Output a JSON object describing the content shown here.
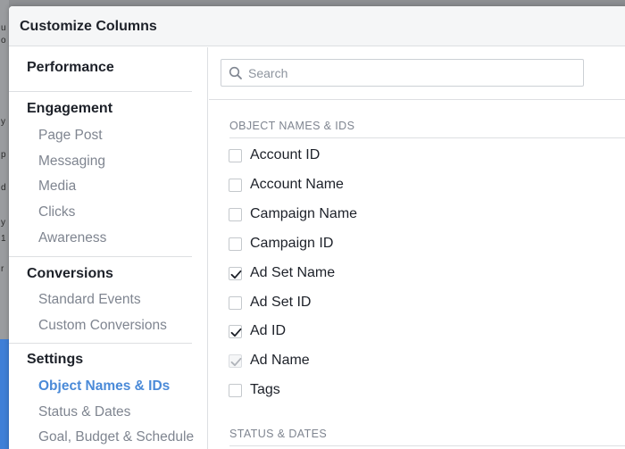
{
  "background": {
    "fragments": [
      "u",
      "o",
      "y",
      "p",
      "d",
      "y",
      "1",
      "r"
    ]
  },
  "modal": {
    "title": "Customize Columns"
  },
  "sidebar": {
    "groups": [
      {
        "heading": "Performance",
        "items": []
      },
      {
        "heading": "Engagement",
        "items": [
          "Page Post",
          "Messaging",
          "Media",
          "Clicks",
          "Awareness"
        ]
      },
      {
        "heading": "Conversions",
        "items": [
          "Standard Events",
          "Custom Conversions"
        ]
      },
      {
        "heading": "Settings",
        "items": [
          "Object Names & IDs",
          "Status & Dates",
          "Goal, Budget & Schedule"
        ]
      }
    ],
    "active_item": "Object Names & IDs"
  },
  "search": {
    "placeholder": "Search",
    "value": ""
  },
  "sections": [
    {
      "title": "OBJECT NAMES & IDS",
      "options": [
        {
          "label": "Account ID",
          "checked": false,
          "disabled": false
        },
        {
          "label": "Account Name",
          "checked": false,
          "disabled": false
        },
        {
          "label": "Campaign Name",
          "checked": false,
          "disabled": false
        },
        {
          "label": "Campaign ID",
          "checked": false,
          "disabled": false
        },
        {
          "label": "Ad Set Name",
          "checked": true,
          "disabled": false
        },
        {
          "label": "Ad Set ID",
          "checked": false,
          "disabled": false
        },
        {
          "label": "Ad ID",
          "checked": true,
          "disabled": false
        },
        {
          "label": "Ad Name",
          "checked": true,
          "disabled": true
        },
        {
          "label": "Tags",
          "checked": false,
          "disabled": false
        }
      ]
    },
    {
      "title": "STATUS & DATES",
      "options": []
    }
  ],
  "colors": {
    "active": "#4a8ad8",
    "check": "#1d2129",
    "check_disabled": "#b0b4ba"
  }
}
